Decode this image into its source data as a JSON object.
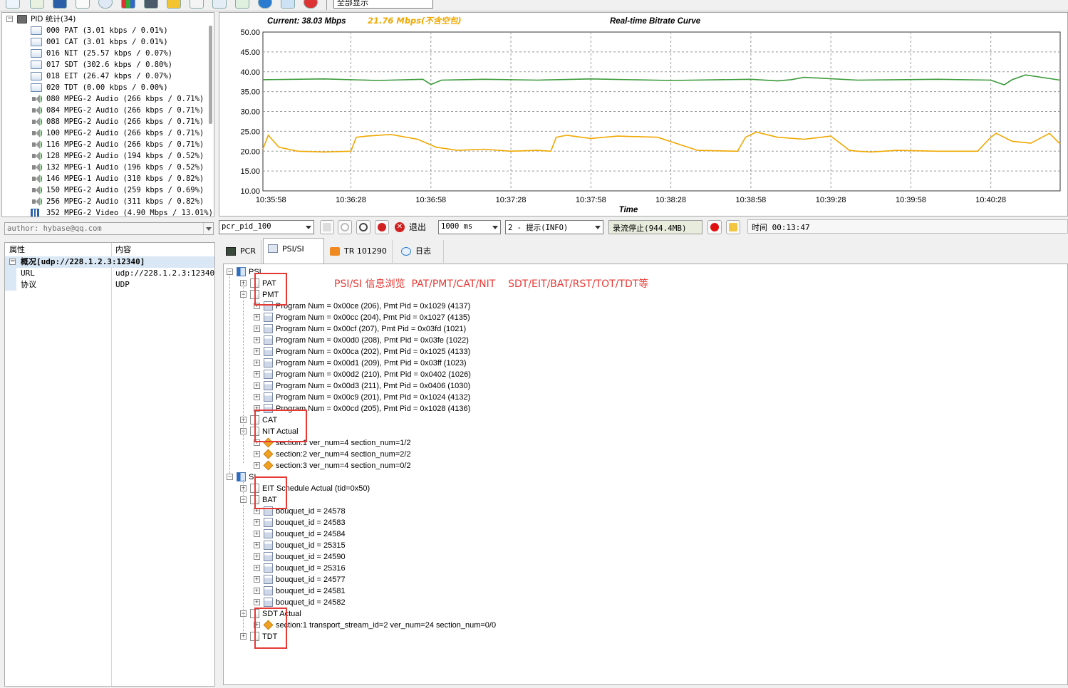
{
  "toolbar": {
    "combo_value": "全部显示"
  },
  "pid_panel": {
    "root": "PID 统计(34)",
    "items": [
      {
        "icon": "doc-icon",
        "label": "000 PAT (3.01 kbps / 0.01%)"
      },
      {
        "icon": "doc-icon",
        "label": "001 CAT (3.01 kbps / 0.01%)"
      },
      {
        "icon": "doc-icon",
        "label": "016 NIT (25.57 kbps / 0.07%)"
      },
      {
        "icon": "doc-icon",
        "label": "017 SDT (302.6 kbps / 0.80%)"
      },
      {
        "icon": "doc-icon",
        "label": "018 EIT (26.47 kbps / 0.07%)"
      },
      {
        "icon": "doc-icon",
        "label": "020 TDT (0.00 kbps / 0.00%)"
      },
      {
        "icon": "speaker-icon",
        "label": "080 MPEG-2 Audio (266 kbps / 0.71%)"
      },
      {
        "icon": "speaker-icon",
        "label": "084 MPEG-2 Audio (266 kbps / 0.71%)"
      },
      {
        "icon": "speaker-icon",
        "label": "088 MPEG-2 Audio (266 kbps / 0.71%)"
      },
      {
        "icon": "speaker-icon",
        "label": "100 MPEG-2 Audio (266 kbps / 0.71%)"
      },
      {
        "icon": "speaker-icon",
        "label": "116 MPEG-2 Audio (266 kbps / 0.71%)"
      },
      {
        "icon": "speaker-icon",
        "label": "128 MPEG-2 Audio (194 kbps / 0.52%)"
      },
      {
        "icon": "speaker-icon",
        "label": "132 MPEG-1 Audio (196 kbps / 0.52%)"
      },
      {
        "icon": "speaker-icon",
        "label": "146 MPEG-1 Audio (310 kbps / 0.82%)"
      },
      {
        "icon": "speaker-icon",
        "label": "150 MPEG-2 Audio (259 kbps / 0.69%)"
      },
      {
        "icon": "speaker-icon",
        "label": "256 MPEG-2 Audio (311 kbps / 0.82%)"
      },
      {
        "icon": "video-icon",
        "label": "352 MPEG-2 Video (4.90 Mbps / 13.01%)"
      }
    ]
  },
  "author": "author: hybase@qq.com",
  "properties": {
    "header_key": "属性",
    "header_value": "内容",
    "group": "概况[udp://228.1.2.3:12340]",
    "rows": [
      {
        "key": "URL",
        "value": "udp://228.1.2.3:12340"
      },
      {
        "key": "协议",
        "value": "UDP"
      }
    ]
  },
  "chart": {
    "current_label": "Current: 38.03 Mbps",
    "secondary_label": "21.76 Mbps(不含空包)",
    "title": "Real-time Bitrate Curve",
    "xlabel": "Time",
    "green": "#3a9a3a",
    "orange": "#f0a800"
  },
  "chart_data": {
    "type": "line",
    "title": "Real-time Bitrate Curve",
    "xlabel": "Time",
    "ylabel": "",
    "ylim": [
      10,
      50
    ],
    "yticks": [
      "50.00",
      "45.00",
      "40.00",
      "35.00",
      "30.00",
      "25.00",
      "20.00",
      "15.00",
      "10.00"
    ],
    "xticks": [
      "10:35:58",
      "10:36:28",
      "10:36:58",
      "10:37:28",
      "10:37:58",
      "10:38:28",
      "10:38:58",
      "10:39:28",
      "10:39:58",
      "10:40:28"
    ],
    "x_range_seconds": [
      -3,
      296
    ],
    "grid": true,
    "series": [
      {
        "name": "",
        "color": "#3a9a3a",
        "x": [
          -3,
          20,
          40,
          57,
          60,
          64,
          80,
          100,
          120,
          150,
          180,
          190,
          195,
          200,
          220,
          250,
          270,
          275,
          278,
          283,
          296
        ],
        "y": [
          38.0,
          38.2,
          37.8,
          38.1,
          36.8,
          37.9,
          38.1,
          37.9,
          38.2,
          37.8,
          38.1,
          37.7,
          38.0,
          38.6,
          37.9,
          38.1,
          37.9,
          36.7,
          38.0,
          39.2,
          37.9
        ]
      },
      {
        "name": "",
        "color": "#f0a800",
        "x": [
          -3,
          -1,
          3,
          10,
          20,
          30,
          32,
          36,
          45,
          55,
          62,
          70,
          80,
          90,
          100,
          105,
          107,
          111,
          120,
          130,
          145,
          160,
          175,
          178,
          182,
          190,
          200,
          210,
          217,
          220,
          225,
          235,
          250,
          265,
          270,
          272,
          278,
          285,
          292,
          296
        ],
        "y": [
          20.5,
          24.0,
          21.0,
          20.0,
          19.8,
          20.0,
          23.5,
          23.8,
          24.2,
          23.0,
          21.0,
          20.2,
          20.5,
          20.0,
          20.2,
          20.0,
          23.5,
          24.0,
          23.2,
          23.8,
          23.5,
          20.2,
          20.0,
          23.5,
          24.8,
          23.5,
          23.0,
          23.8,
          20.2,
          20.0,
          19.8,
          20.2,
          20.0,
          20.0,
          23.5,
          24.5,
          22.5,
          22.0,
          24.5,
          21.8
        ]
      }
    ]
  },
  "controls": {
    "pid_select": "pcr_pid_100",
    "exit_label": "退出",
    "interval_select": "1000 ms",
    "log_level_select": "2 - 提示(INFO)",
    "record_status": "录流停止(944.4MB)",
    "time_label": "时间 00:13:47"
  },
  "tabs": [
    {
      "label": "PCR",
      "active": false
    },
    {
      "label": "PSI/SI",
      "active": true
    },
    {
      "label": "TR 101290",
      "active": false
    },
    {
      "label": "日志",
      "active": false
    }
  ],
  "tree": {
    "psi_root": "PSI",
    "pat": "PAT",
    "pmt": "PMT",
    "pmt_children": [
      "Program Num = 0x00ce (206), Pmt Pid = 0x1029 (4137)",
      "Program Num = 0x00cc (204), Pmt Pid = 0x1027 (4135)",
      "Program Num = 0x00cf (207), Pmt Pid = 0x03fd (1021)",
      "Program Num = 0x00d0 (208), Pmt Pid = 0x03fe (1022)",
      "Program Num = 0x00ca (202), Pmt Pid = 0x1025 (4133)",
      "Program Num = 0x00d1 (209), Pmt Pid = 0x03ff (1023)",
      "Program Num = 0x00d2 (210), Pmt Pid = 0x0402 (1026)",
      "Program Num = 0x00d3 (211), Pmt Pid = 0x0406 (1030)",
      "Program Num = 0x00c9 (201), Pmt Pid = 0x1024 (4132)",
      "Program Num = 0x00cd (205), Pmt Pid = 0x1028 (4136)"
    ],
    "cat": "CAT",
    "nit": "NIT Actual",
    "nit_children": [
      "section:1 ver_num=4 section_num=1/2",
      "section:2 ver_num=4 section_num=2/2",
      "section:3 ver_num=4 section_num=0/2"
    ],
    "si_root": "SI",
    "eit": "EIT Schedule Actual (tid=0x50)",
    "bat": "BAT",
    "bat_children": [
      "bouquet_id = 24578",
      "bouquet_id = 24583",
      "bouquet_id = 24584",
      "bouquet_id = 25315",
      "bouquet_id = 24590",
      "bouquet_id = 25316",
      "bouquet_id = 24577",
      "bouquet_id = 24581",
      "bouquet_id = 24582"
    ],
    "sdt": "SDT Actual",
    "sdt_children": [
      "section:1 transport_stream_id=2 ver_num=24 section_num=0/0"
    ],
    "tdt": "TDT"
  },
  "annotation": "PSI/SI 信息浏览  PAT/PMT/CAT/NIT    SDT/EIT/BAT/RST/TOT/TDT等",
  "colors": {
    "highlight": "#e53935",
    "annotation": "#e53935"
  }
}
